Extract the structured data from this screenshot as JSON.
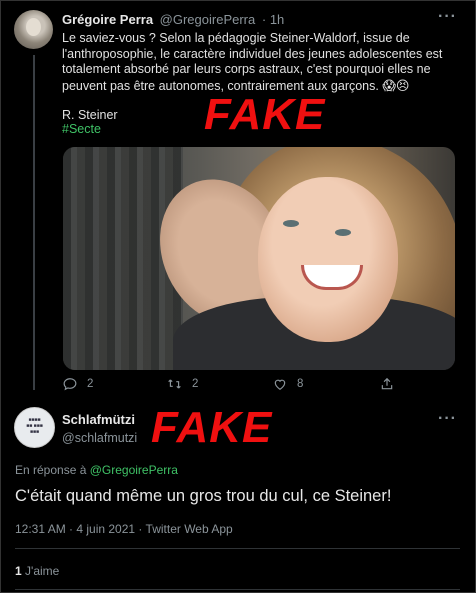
{
  "tweet1": {
    "display_name": "Grégoire Perra",
    "handle": "@GregoirePerra",
    "time": "· 1h",
    "more": "···",
    "body_lines": [
      "Le saviez-vous ? Selon la pédagogie Steiner-Waldorf, issue de",
      "l'anthroposophie, le caractère individuel des jeunes adolescentes est",
      "totalement absorbé par leurs corps astraux, c'est pourquoi elles ne",
      "peuvent pas être autonomes, contrairement aux garçons."
    ],
    "emojis": "😱😣",
    "signature": "R. Steiner",
    "hashtag": "#Secte",
    "actions": {
      "reply_count": "2",
      "retweet_count": "2",
      "like_count": "8"
    }
  },
  "stamps": {
    "fake_top": "FAKE",
    "fake_bottom": "FAKE"
  },
  "tweet2": {
    "display_name": "Schlafmützi",
    "handle": "@schlafmutzi",
    "more": "···",
    "reply_prefix": "En réponse à",
    "reply_handle": "@GregoirePerra",
    "body": "C'était quand même un gros trou du cul, ce Steiner!",
    "meta": "12:31 AM · 4 juin 2021 · Twitter Web App",
    "likes_count": "1",
    "likes_label": "J'aime"
  },
  "colors": {
    "background": "#000000",
    "accent_green": "#3fc266",
    "stamp_red": "#f01010",
    "muted": "#8b949a"
  }
}
